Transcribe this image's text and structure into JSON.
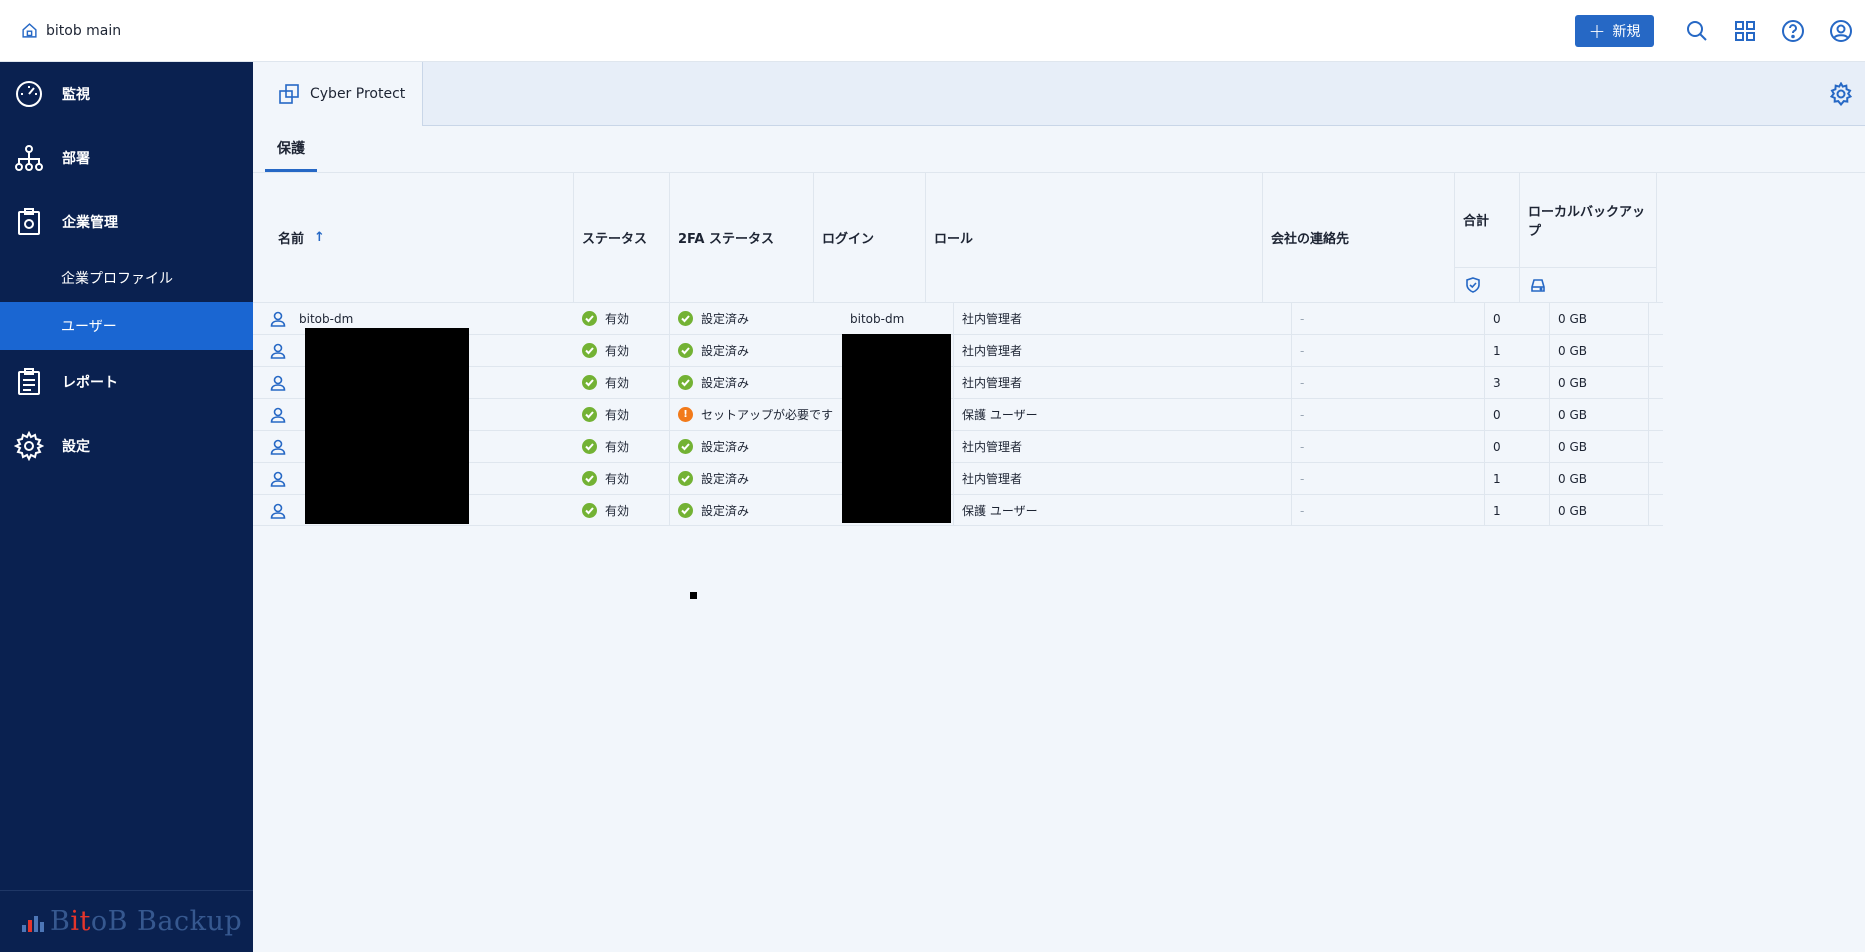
{
  "header": {
    "tenant_name": "bitob main",
    "new_button_label": "新規"
  },
  "sidebar": {
    "items": [
      {
        "label": "監視",
        "icon": "dashboard-gauge-icon"
      },
      {
        "label": "部署",
        "icon": "org-tree-icon"
      },
      {
        "label": "企業管理",
        "icon": "clipboard-gear-icon"
      },
      {
        "label": "企業プロファイル",
        "sub": true
      },
      {
        "label": "ユーザー",
        "sub": true,
        "active": true
      },
      {
        "label": "レポート",
        "icon": "report-clipboard-icon"
      },
      {
        "label": "設定",
        "icon": "gear-icon"
      }
    ],
    "brand": {
      "prefix": "B",
      "accent": "it",
      "suffix": "oB Backup"
    }
  },
  "product_tab": {
    "label": "Cyber Protect"
  },
  "subtab": {
    "label": "保護"
  },
  "table": {
    "columns": {
      "name": "名前",
      "status": "ステータス",
      "twofa": "2FA ステータス",
      "login": "ログイン",
      "role": "ロール",
      "contact": "会社の連絡先",
      "total": "合計",
      "local_backup": "ローカルバックアップ"
    },
    "sort_indicator": "↑",
    "rows": [
      {
        "name": "bitob-dm",
        "status": "有効",
        "twofa": "設定済み",
        "twofa_state": "ok",
        "login": "bitob-dm",
        "role": "社内管理者",
        "contact": "-",
        "total": "0",
        "backup": "0 GB"
      },
      {
        "name": "",
        "status": "有効",
        "twofa": "設定済み",
        "twofa_state": "ok",
        "login": "",
        "role": "社内管理者",
        "contact": "-",
        "total": "1",
        "backup": "0 GB"
      },
      {
        "name": "",
        "status": "有効",
        "twofa": "設定済み",
        "twofa_state": "ok",
        "login": "",
        "role": "社内管理者",
        "contact": "-",
        "total": "3",
        "backup": "0 GB"
      },
      {
        "name": "",
        "status": "有効",
        "twofa": "セットアップが必要です",
        "twofa_state": "warn",
        "login": "",
        "role": "保護 ユーザー",
        "contact": "-",
        "total": "0",
        "backup": "0 GB"
      },
      {
        "name": "",
        "status": "有効",
        "twofa": "設定済み",
        "twofa_state": "ok",
        "login": "",
        "role": "社内管理者",
        "contact": "-",
        "total": "0",
        "backup": "0 GB"
      },
      {
        "name": "",
        "status": "有効",
        "twofa": "設定済み",
        "twofa_state": "ok",
        "login": "",
        "role": "社内管理者",
        "contact": "-",
        "total": "1",
        "backup": "0 GB"
      },
      {
        "name": "",
        "status": "有効",
        "twofa": "設定済み",
        "twofa_state": "ok",
        "login": "",
        "role": "保護 ユーザー",
        "contact": "-",
        "total": "1",
        "backup": "0 GB"
      }
    ]
  },
  "colors": {
    "sidebar_bg": "#0a2150",
    "accent": "#2668c5",
    "active_nav": "#1a66d2",
    "ok": "#73b234",
    "warn": "#f27a1a"
  }
}
